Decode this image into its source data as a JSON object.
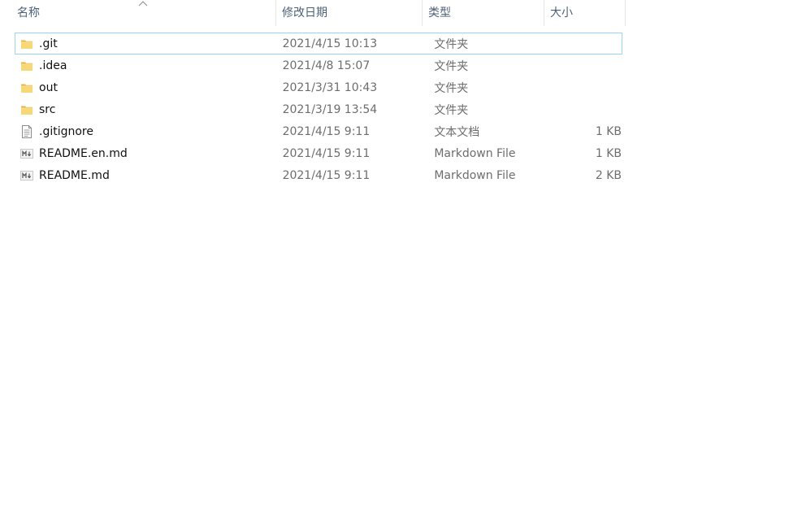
{
  "columns": {
    "name": "名称",
    "date": "修改日期",
    "type": "类型",
    "size": "大小"
  },
  "sort": {
    "column": "name",
    "direction": "ascending",
    "icon": "chevron-up-icon"
  },
  "files": [
    {
      "name": ".git",
      "date": "2021/4/15 10:13",
      "type": "文件夹",
      "size": "",
      "icon": "folder-icon",
      "focused": true
    },
    {
      "name": ".idea",
      "date": "2021/4/8 15:07",
      "type": "文件夹",
      "size": "",
      "icon": "folder-icon"
    },
    {
      "name": "out",
      "date": "2021/3/31 10:43",
      "type": "文件夹",
      "size": "",
      "icon": "folder-icon"
    },
    {
      "name": "src",
      "date": "2021/3/19 13:54",
      "type": "文件夹",
      "size": "",
      "icon": "folder-icon"
    },
    {
      "name": ".gitignore",
      "date": "2021/4/15 9:11",
      "type": "文本文档",
      "size": "1 KB",
      "icon": "text-document-icon"
    },
    {
      "name": "README.en.md",
      "date": "2021/4/15 9:11",
      "type": "Markdown File",
      "size": "1 KB",
      "icon": "markdown-file-icon"
    },
    {
      "name": "README.md",
      "date": "2021/4/15 9:11",
      "type": "Markdown File",
      "size": "2 KB",
      "icon": "markdown-file-icon"
    }
  ],
  "colors": {
    "header_text": "#4c607a",
    "focus_border": "#99d1ff",
    "folder": "#f8d775"
  }
}
